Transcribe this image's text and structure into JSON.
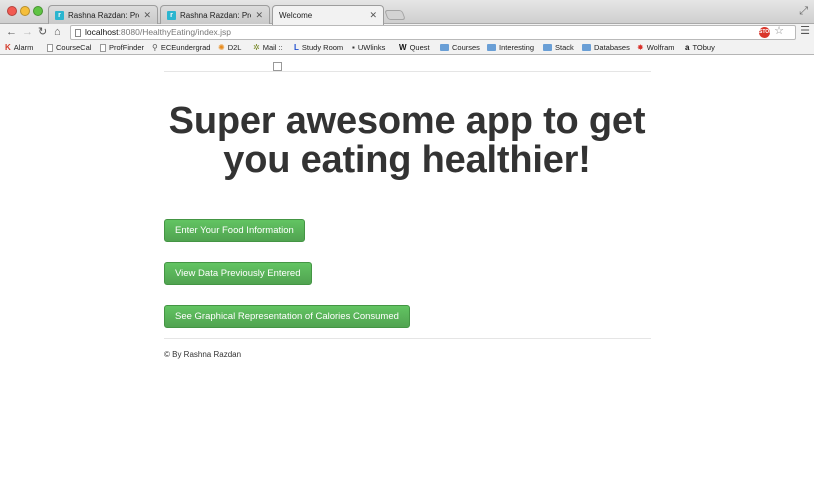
{
  "browser": {
    "tabs": [
      {
        "title": "Rashna Razdan: Projects",
        "active": false
      },
      {
        "title": "Rashna Razdan: Projects",
        "active": false
      },
      {
        "title": "Welcome",
        "active": true
      }
    ],
    "url_host": "localhost",
    "url_path": ":8080/HealthyEating/index.jsp",
    "bookmarks": [
      {
        "label": "Alarm",
        "icon": "k-icon"
      },
      {
        "label": "CourseCal",
        "icon": "doc-icon"
      },
      {
        "label": "ProfFinder",
        "icon": "doc-icon"
      },
      {
        "label": "ECEundergrad",
        "icon": "link-icon"
      },
      {
        "label": "D2L",
        "icon": "sun-icon"
      },
      {
        "label": "Mail ::",
        "icon": "gear-icon"
      },
      {
        "label": "Study Room",
        "icon": "l-icon"
      },
      {
        "label": "UWlinks",
        "icon": "camera-icon"
      },
      {
        "label": "Quest",
        "icon": "w-icon"
      },
      {
        "label": "Courses",
        "icon": "folder-icon"
      },
      {
        "label": "Interesting",
        "icon": "folder-icon"
      },
      {
        "label": "Stack",
        "icon": "folder-icon"
      },
      {
        "label": "Databases",
        "icon": "folder-icon"
      },
      {
        "label": "Wolfram",
        "icon": "wolfram-icon"
      },
      {
        "label": "TObuy",
        "icon": "amazon-icon"
      }
    ]
  },
  "main": {
    "headline": "Super awesome app to get you eating healthier!",
    "buttons": {
      "enter": "Enter Your Food Information",
      "view": "View Data Previously Entered",
      "graph": "See Graphical Representation of Calories Consumed"
    },
    "footer": "© By Rashna Razdan"
  },
  "colors": {
    "button_green": "#5cb85c",
    "heading_text": "#333333"
  }
}
